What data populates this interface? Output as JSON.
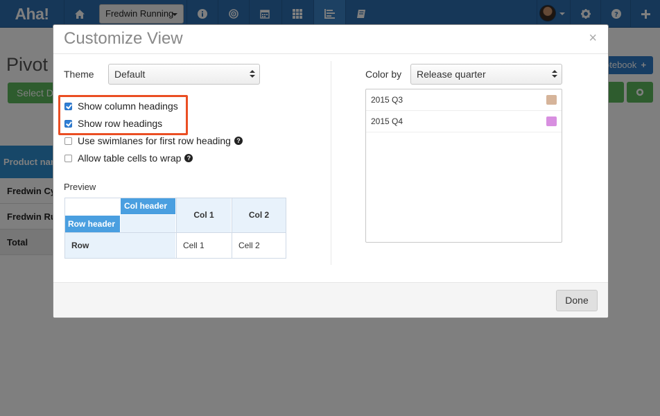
{
  "app": {
    "logo": "Aha!",
    "workspace": "Fredwin Running"
  },
  "background": {
    "page_title": "Pivot ta",
    "select_button": "Select D",
    "notebook_button": "otebook",
    "table_header": "Product nam",
    "rows": [
      "Fredwin Cyc",
      "Fredwin Run",
      "Total"
    ]
  },
  "modal": {
    "title": "Customize View",
    "close": "×",
    "theme_label": "Theme",
    "theme_value": "Default",
    "checkboxes": [
      {
        "label": "Show column headings",
        "checked": true
      },
      {
        "label": "Show row headings",
        "checked": true
      },
      {
        "label": "Use swimlanes for first row heading",
        "checked": false,
        "help": "?"
      },
      {
        "label": "Allow table cells to wrap",
        "checked": false,
        "help": "?"
      }
    ],
    "preview": {
      "label": "Preview",
      "col_header": "Col header",
      "row_header": "Row header",
      "col1": "Col 1",
      "col2": "Col 2",
      "row": "Row",
      "cell1": "Cell 1",
      "cell2": "Cell 2"
    },
    "color_by_label": "Color by",
    "color_by_value": "Release quarter",
    "color_items": [
      {
        "label": "2015 Q3",
        "color": "#d6b49a"
      },
      {
        "label": "2015 Q4",
        "color": "#d88fe0"
      }
    ],
    "done_label": "Done"
  },
  "colors": {
    "nav": "#2c6fb0",
    "highlight": "#ea4e23",
    "checkbox": "#2f7fd6",
    "preview_header": "#4a9fe0"
  }
}
